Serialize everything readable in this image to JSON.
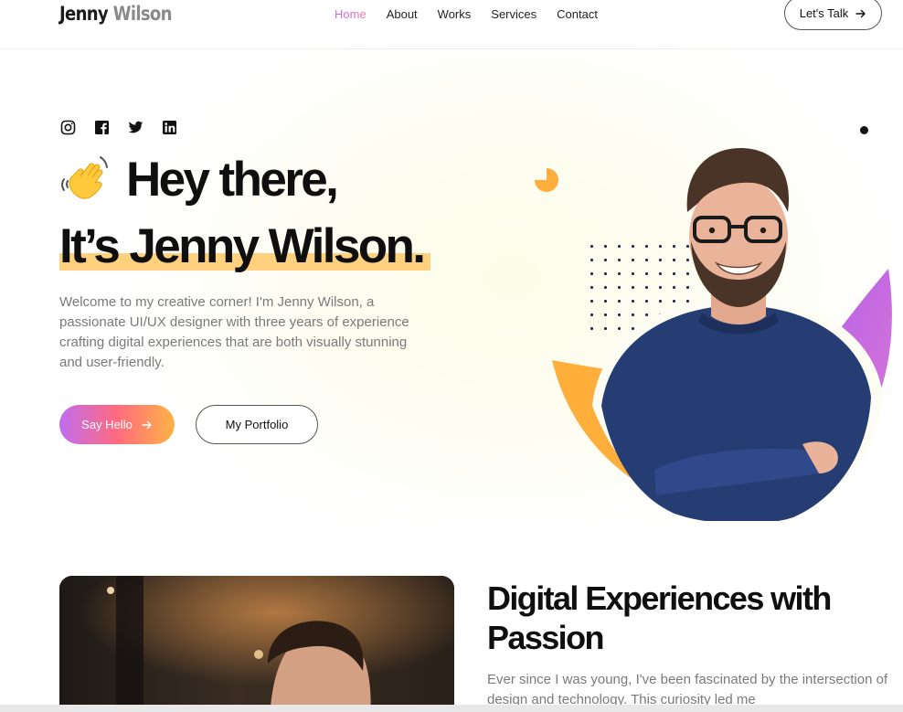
{
  "brand": {
    "first": "Jenny",
    "last": "Wilson"
  },
  "nav": {
    "items": [
      {
        "label": "Home",
        "active": true
      },
      {
        "label": "About"
      },
      {
        "label": "Works"
      },
      {
        "label": "Services"
      },
      {
        "label": "Contact"
      }
    ],
    "cta_label": "Let's Talk",
    "cta_icon": "arrow-right-icon"
  },
  "hero": {
    "socials": [
      "instagram-icon",
      "facebook-icon",
      "twitter-icon",
      "linkedin-icon"
    ],
    "greeting_icon": "waving-hand-icon",
    "line1": "Hey there,",
    "line2": "It’s Jenny Wilson.",
    "description": "Welcome to my creative corner! I'm Jenny Wilson, a passionate UI/UX designer with three years of experience crafting digital experiences that are both visually stunning and user-friendly.",
    "primary_button": "Say Hello",
    "secondary_button": "My Portfolio"
  },
  "about": {
    "title": "Digital Experiences with Passion",
    "description": "Ever since I was young, I've been fascinated by the intersection of design and technology. This curiosity led me"
  },
  "colors": {
    "accent_orange": "#ffad3b",
    "accent_purple": "#b35fe8",
    "accent_pink": "#ff6fa1",
    "highlight": "#ffd07d",
    "text_dark": "#0f0f0f",
    "text_muted": "#7a7a7a"
  }
}
